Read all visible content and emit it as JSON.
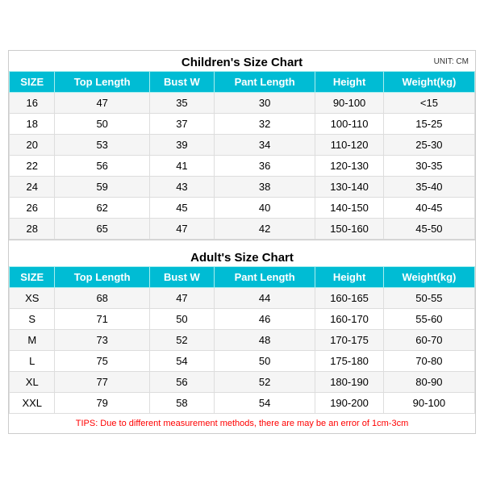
{
  "children_section": {
    "title": "Children's Size Chart",
    "unit": "UNIT: CM",
    "headers": [
      "SIZE",
      "Top Length",
      "Bust W",
      "Pant Length",
      "Height",
      "Weight(kg)"
    ],
    "rows": [
      [
        "16",
        "47",
        "35",
        "30",
        "90-100",
        "<15"
      ],
      [
        "18",
        "50",
        "37",
        "32",
        "100-110",
        "15-25"
      ],
      [
        "20",
        "53",
        "39",
        "34",
        "110-120",
        "25-30"
      ],
      [
        "22",
        "56",
        "41",
        "36",
        "120-130",
        "30-35"
      ],
      [
        "24",
        "59",
        "43",
        "38",
        "130-140",
        "35-40"
      ],
      [
        "26",
        "62",
        "45",
        "40",
        "140-150",
        "40-45"
      ],
      [
        "28",
        "65",
        "47",
        "42",
        "150-160",
        "45-50"
      ]
    ]
  },
  "adult_section": {
    "title": "Adult's Size Chart",
    "headers": [
      "SIZE",
      "Top Length",
      "Bust W",
      "Pant Length",
      "Height",
      "Weight(kg)"
    ],
    "rows": [
      [
        "XS",
        "68",
        "47",
        "44",
        "160-165",
        "50-55"
      ],
      [
        "S",
        "71",
        "50",
        "46",
        "160-170",
        "55-60"
      ],
      [
        "M",
        "73",
        "52",
        "48",
        "170-175",
        "60-70"
      ],
      [
        "L",
        "75",
        "54",
        "50",
        "175-180",
        "70-80"
      ],
      [
        "XL",
        "77",
        "56",
        "52",
        "180-190",
        "80-90"
      ],
      [
        "XXL",
        "79",
        "58",
        "54",
        "190-200",
        "90-100"
      ]
    ]
  },
  "tips": "TIPS: Due to different measurement methods, there are may be an error of 1cm-3cm"
}
